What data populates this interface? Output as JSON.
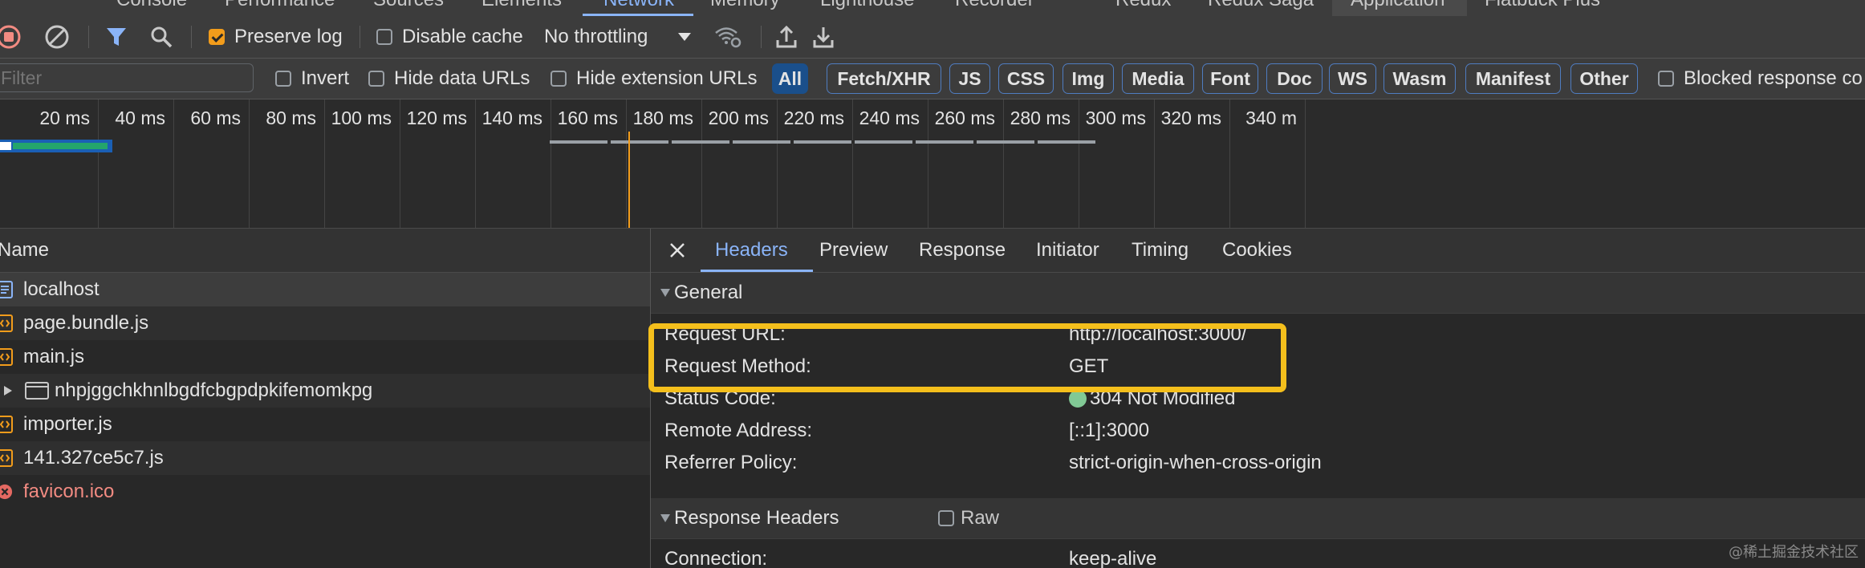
{
  "top_tabs": [
    "Console",
    "Performance",
    "Sources",
    "Elements",
    "Network",
    "Memory",
    "Lighthouse",
    "Recorder",
    "Redux",
    "Redux Saga",
    "Application",
    "Flatbuck Plus"
  ],
  "toolbar": {
    "preserve_log_label": "Preserve log",
    "preserve_log_checked": true,
    "disable_cache_label": "Disable cache",
    "disable_cache_checked": false,
    "throttling_value": "No throttling"
  },
  "filter": {
    "placeholder": "Filter",
    "invert_label": "Invert",
    "hide_data_urls_label": "Hide data URLs",
    "hide_extension_urls_label": "Hide extension URLs",
    "types": [
      "All",
      "Fetch/XHR",
      "JS",
      "CSS",
      "Img",
      "Media",
      "Font",
      "Doc",
      "WS",
      "Wasm",
      "Manifest",
      "Other"
    ],
    "active_type": "All",
    "blocked_label": "Blocked response co"
  },
  "timeline": {
    "ticks": [
      "20 ms",
      "40 ms",
      "60 ms",
      "80 ms",
      "100 ms",
      "120 ms",
      "140 ms",
      "160 ms",
      "180 ms",
      "200 ms",
      "220 ms",
      "240 ms",
      "260 ms",
      "280 ms",
      "300 ms",
      "320 ms",
      "340 m"
    ]
  },
  "request_list": {
    "header": "Name",
    "rows": [
      {
        "name": "localhost",
        "type": "doc"
      },
      {
        "name": "page.bundle.js",
        "type": "script"
      },
      {
        "name": "main.js",
        "type": "script"
      },
      {
        "name": "nhpjggchkhnlbgdfcbgpdpkifemomkpg",
        "type": "folder"
      },
      {
        "name": "importer.js",
        "type": "script"
      },
      {
        "name": "141.327ce5c7.js",
        "type": "script"
      },
      {
        "name": "favicon.ico",
        "type": "error"
      }
    ]
  },
  "details": {
    "tabs": [
      "Headers",
      "Preview",
      "Response",
      "Initiator",
      "Timing",
      "Cookies"
    ],
    "active_tab": "Headers",
    "general_title": "General",
    "general": [
      {
        "key": "Request URL:",
        "value": "http://localhost:3000/"
      },
      {
        "key": "Request Method:",
        "value": "GET"
      },
      {
        "key": "Status Code:",
        "value": "304 Not Modified"
      },
      {
        "key": "Remote Address:",
        "value": "[::1]:3000"
      },
      {
        "key": "Referrer Policy:",
        "value": "strict-origin-when-cross-origin"
      }
    ],
    "response_headers_title": "Response Headers",
    "raw_label": "Raw",
    "response_headers": [
      {
        "key": "Connection:",
        "value": "keep-alive"
      }
    ]
  },
  "watermark": "@稀土掘金技术社区",
  "colors": {
    "accent": "#8ab4f8",
    "highlight": "#f4bf1c",
    "error": "#f28b82",
    "status_ok": "#81c995",
    "checkbox_on": "#f29c1b"
  }
}
